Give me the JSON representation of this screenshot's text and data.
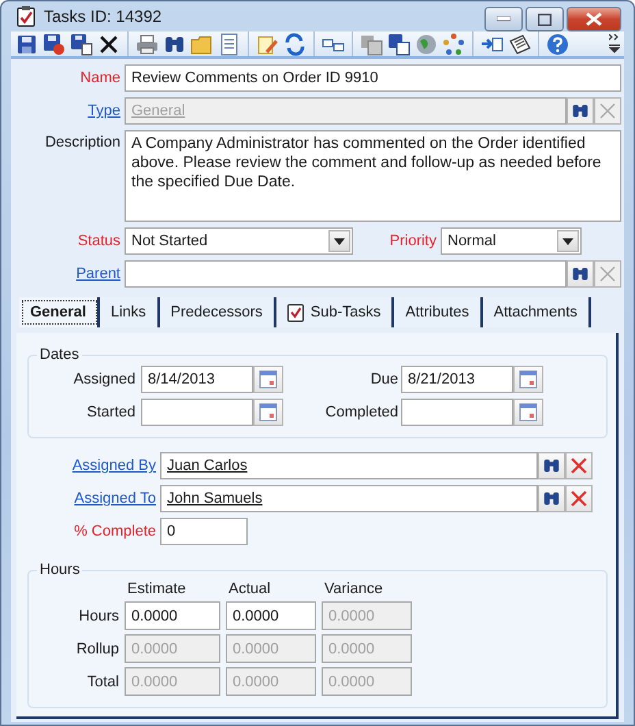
{
  "window": {
    "title": "Tasks ID: 14392"
  },
  "fields": {
    "name": {
      "label": "Name",
      "required": true,
      "link": false,
      "value": "Review Comments on Order ID 9910"
    },
    "type": {
      "label": "Type",
      "required": false,
      "link": true,
      "value": "General",
      "disabled": true
    },
    "description": {
      "label": "Description",
      "required": false,
      "link": false,
      "value": "A Company Administrator has commented on the Order identified above. Please review the comment and follow-up as needed before the specified Due Date."
    },
    "status": {
      "label": "Status",
      "required": true,
      "link": false,
      "value": "Not Started"
    },
    "priority": {
      "label": "Priority",
      "required": true,
      "link": false,
      "value": "Normal"
    },
    "parent": {
      "label": "Parent",
      "required": false,
      "link": true
    }
  },
  "tabs": [
    {
      "label": "General",
      "selected": true,
      "kind": "text"
    },
    {
      "label": "Links",
      "selected": false,
      "kind": "text"
    },
    {
      "label": "Predecessors",
      "selected": false,
      "kind": "text"
    },
    {
      "label": "Sub-Tasks",
      "selected": false,
      "kind": "checklist"
    },
    {
      "label": "Attributes",
      "selected": false,
      "kind": "text"
    },
    {
      "label": "Attachments",
      "selected": false,
      "kind": "text"
    }
  ],
  "dates": {
    "title": "Dates",
    "items": [
      {
        "label": "Assigned",
        "value": "8/14/2013"
      },
      {
        "label": "Due",
        "value": "8/21/2013"
      },
      {
        "label": "Started"
      },
      {
        "label": "Completed"
      }
    ]
  },
  "people": [
    {
      "label": "Assigned By",
      "value": "Juan Carlos"
    },
    {
      "label": "Assigned To",
      "value": "John Samuels"
    }
  ],
  "percent_complete": {
    "label": "% Complete",
    "required": true,
    "value": "0"
  },
  "hours": {
    "title": "Hours",
    "columns": [
      "Estimate",
      "Actual",
      "Variance"
    ],
    "rows": [
      {
        "label": "Hours",
        "cells": [
          {
            "value": "0.0000",
            "disabled": false
          },
          {
            "value": "0.0000",
            "disabled": false
          },
          {
            "value": "0.0000",
            "disabled": true
          }
        ]
      },
      {
        "label": "Rollup",
        "cells": [
          {
            "value": "0.0000",
            "disabled": true
          },
          {
            "value": "0.0000",
            "disabled": true
          },
          {
            "value": "0.0000",
            "disabled": true
          }
        ]
      },
      {
        "label": "Total",
        "cells": [
          {
            "value": "0.0000",
            "disabled": true
          },
          {
            "value": "0.0000",
            "disabled": true
          },
          {
            "value": "0.0000",
            "disabled": true
          }
        ]
      }
    ]
  }
}
